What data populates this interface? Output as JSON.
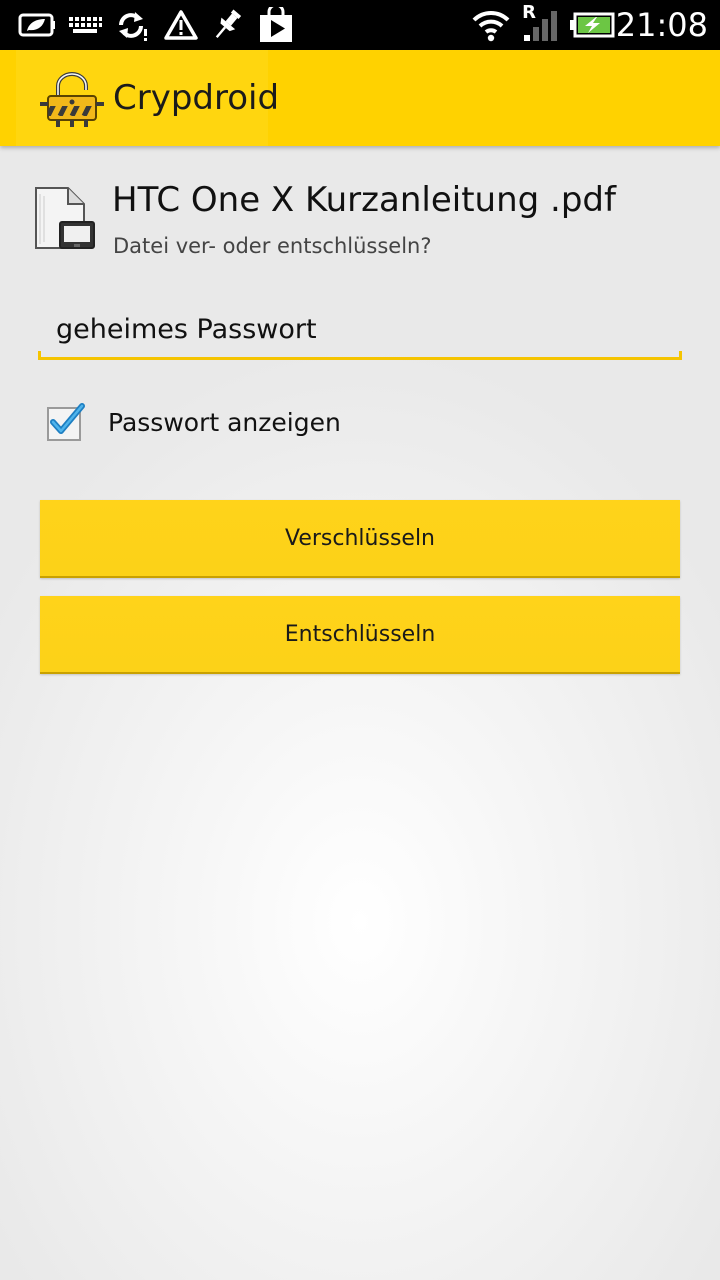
{
  "status_bar": {
    "time": "21:08",
    "icons": [
      "screenshot-icon",
      "keyboard-icon",
      "sync-icon",
      "warning-icon",
      "pin-icon",
      "play-store-icon",
      "wifi-icon",
      "signal-icon",
      "battery-charging-icon"
    ],
    "roaming_label": "R"
  },
  "action_bar": {
    "title": "Crypdroid",
    "color": "#ffd200"
  },
  "file": {
    "name": "HTC One X Kurzanleitung .pdf",
    "prompt": "Datei ver- oder entschlüsseln?"
  },
  "password": {
    "value": "geheimes Passwort"
  },
  "show_password": {
    "label": "Passwort anzeigen",
    "checked": true
  },
  "buttons": {
    "encrypt_label": "Verschlüsseln",
    "decrypt_label": "Entschlüsseln",
    "color": "#ffd31a"
  }
}
